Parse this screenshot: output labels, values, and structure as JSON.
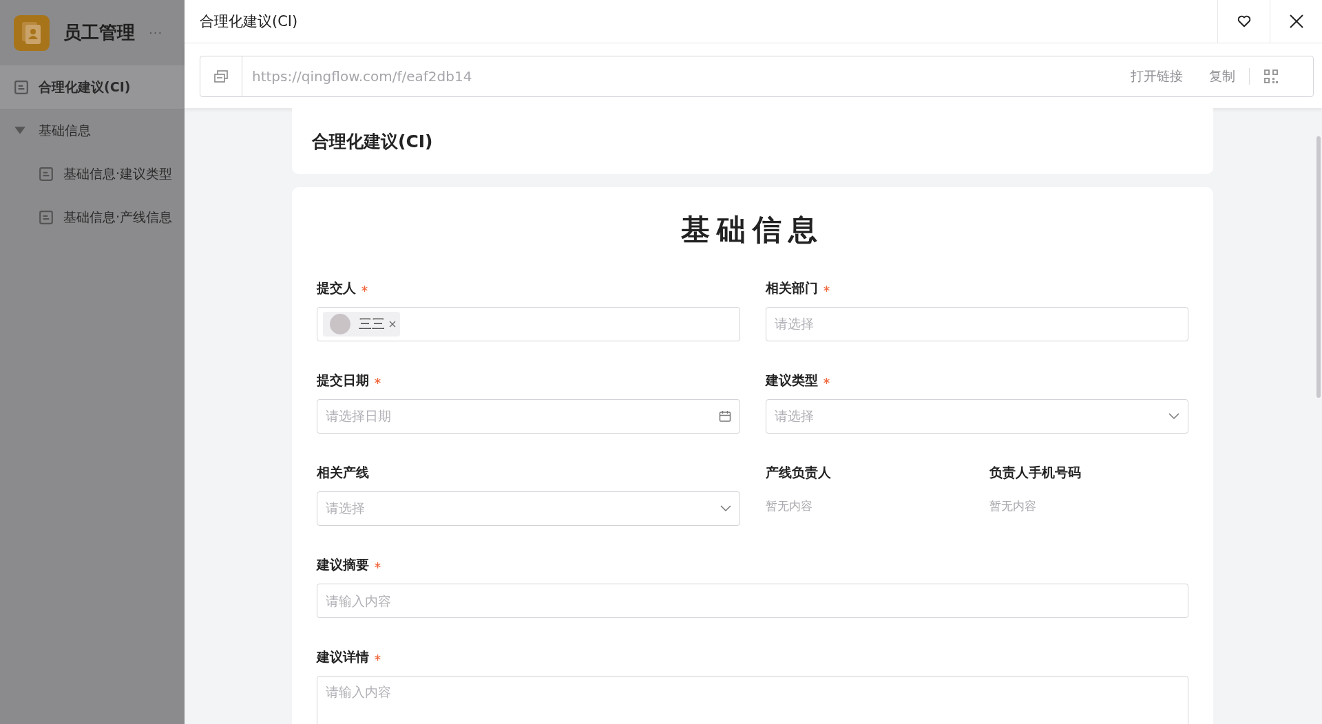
{
  "sidebar": {
    "app_name": "员工管理",
    "more": "···",
    "items": [
      {
        "kind": "form",
        "label": "合理化建议(CI)",
        "selected": true
      },
      {
        "kind": "group",
        "label": "基础信息",
        "selected": false,
        "expanded": true,
        "children": [
          {
            "label": "基础信息·建议类型",
            "selected": false
          },
          {
            "label": "基础信息·产线信息",
            "selected": false
          }
        ]
      }
    ]
  },
  "drawer": {
    "title": "合理化建议(CI)",
    "url": "https://qingflow.com/f/eaf2db14",
    "url_actions": [
      "打开链接",
      "复制"
    ]
  },
  "form": {
    "title": "合理化建议(CI)",
    "section_title": "基础信息",
    "fields": [
      {
        "kind": "member",
        "label": "提交人",
        "required": true,
        "tags": [
          "三三"
        ]
      },
      {
        "kind": "picker",
        "label": "相关部门",
        "required": true,
        "placeholder": "请选择"
      },
      {
        "kind": "date",
        "label": "提交日期",
        "required": true,
        "placeholder": "请选择日期"
      },
      {
        "kind": "select",
        "label": "建议类型",
        "required": true,
        "placeholder": "请选择"
      },
      {
        "kind": "select",
        "label": "相关产线",
        "required": false,
        "placeholder": "请选择"
      },
      {
        "kind": "readonly",
        "label": "产线负责人",
        "required": false,
        "value": "暂无内容"
      },
      {
        "kind": "readonly",
        "label": "负责人手机号码",
        "required": false,
        "value": "暂无内容"
      },
      {
        "kind": "input",
        "label": "建议摘要",
        "required": true,
        "placeholder": "请输入内容"
      },
      {
        "kind": "textarea",
        "label": "建议详情",
        "required": true,
        "placeholder": "请输入内容"
      }
    ]
  }
}
